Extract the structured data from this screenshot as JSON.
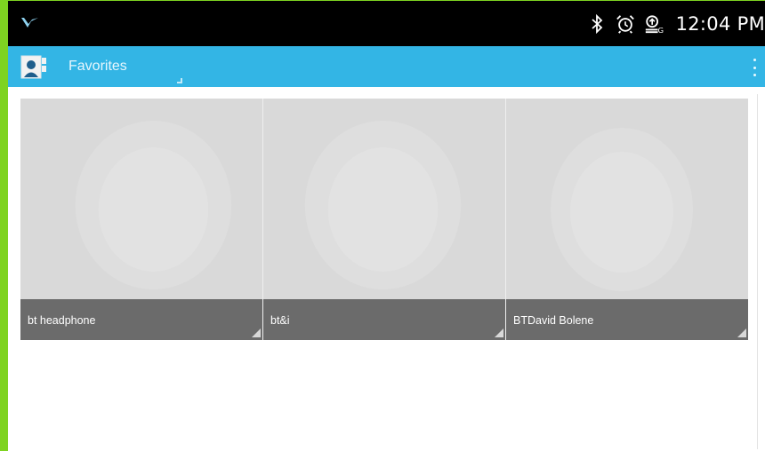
{
  "status_bar": {
    "time": "12:04 PM",
    "icons": [
      "notification-logo-icon",
      "bluetooth-icon",
      "alarm-icon",
      "sync-icon"
    ]
  },
  "action_bar": {
    "title": "Favorites",
    "app_icon": "contact-card-icon",
    "overflow_icon": "overflow-menu-icon"
  },
  "favorites": [
    {
      "name": "bt headphone"
    },
    {
      "name": "bt&i"
    },
    {
      "name": "BTDavid Bolene"
    }
  ],
  "colors": {
    "status_bar": "#000000",
    "action_bar": "#33b5e5",
    "tile_label": "#6b6b6b",
    "tile_photo": "#d9d9d9",
    "frame": "#7ed321"
  }
}
